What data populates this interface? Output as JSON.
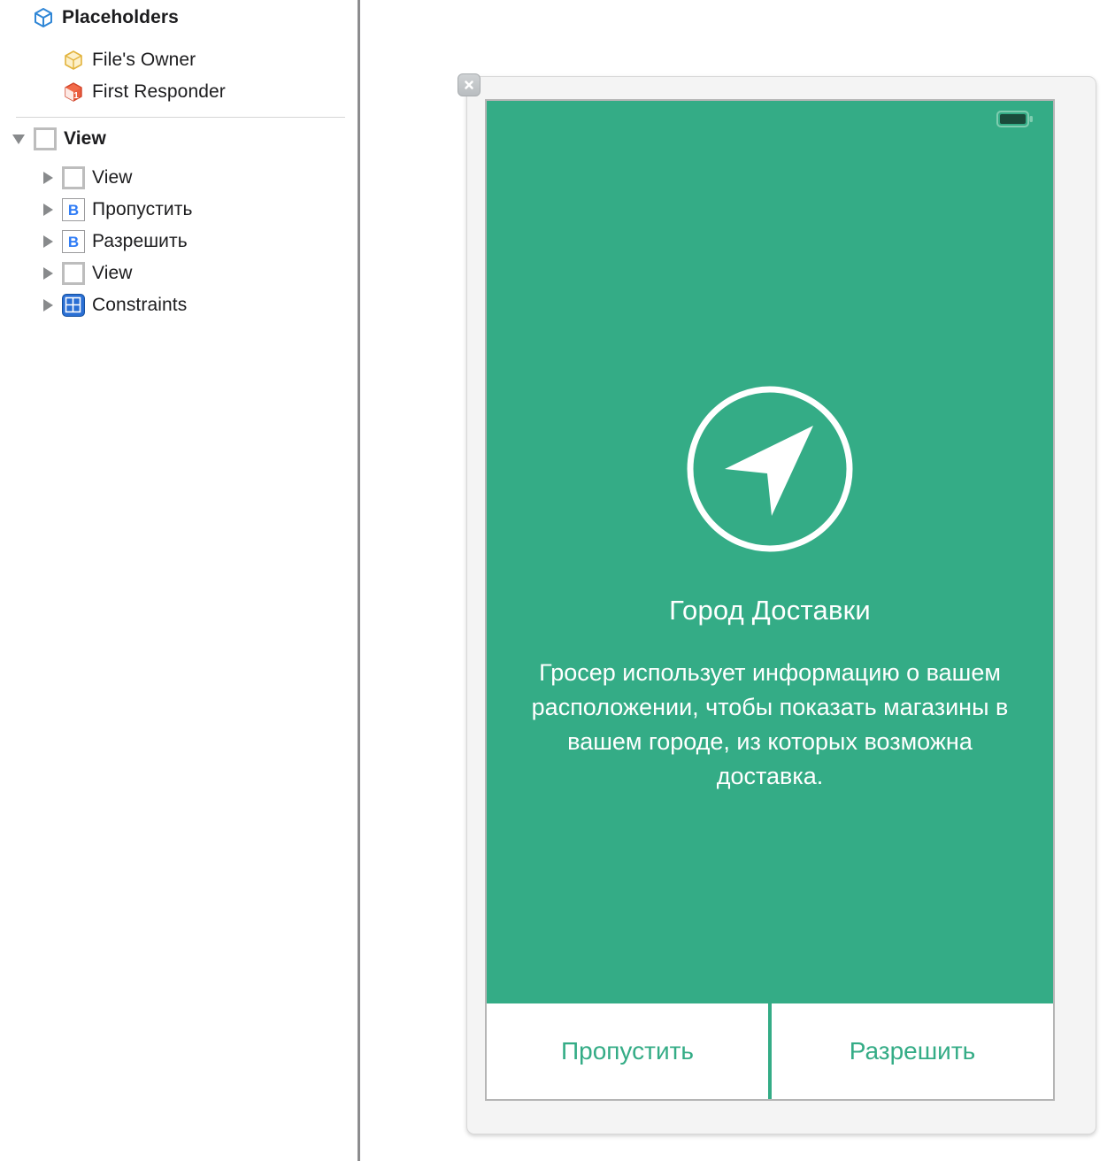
{
  "outline": {
    "sections": [
      {
        "header": {
          "label": "Placeholders",
          "icon": "cube-blue-icon"
        },
        "items": [
          {
            "label": "File's Owner",
            "icon": "cube-yellow-icon"
          },
          {
            "label": "First Responder",
            "icon": "cube-orange-one-icon"
          }
        ]
      }
    ],
    "tree": [
      {
        "label": "View",
        "icon": "view-icon",
        "disclosure": "open",
        "depth": 0,
        "bold": true
      },
      {
        "label": "View",
        "icon": "view-icon",
        "disclosure": "closed",
        "depth": 1,
        "bold": false
      },
      {
        "label": "Пропустить",
        "icon": "button-icon",
        "disclosure": "closed",
        "depth": 1,
        "bold": false
      },
      {
        "label": "Разрешить",
        "icon": "button-icon",
        "disclosure": "closed",
        "depth": 1,
        "bold": false
      },
      {
        "label": "View",
        "icon": "view-icon",
        "disclosure": "closed",
        "depth": 1,
        "bold": false
      },
      {
        "label": "Constraints",
        "icon": "constraints-icon",
        "disclosure": "closed",
        "depth": 1,
        "bold": false
      }
    ]
  },
  "canvas": {
    "close_button": {
      "icon": "close-icon"
    },
    "device": {
      "status_bar": {
        "battery_icon": "battery-full-icon"
      },
      "screen": {
        "background_color": "#34ac86",
        "hero_icon": "location-arrow-circle-icon",
        "title": "Город Доставки",
        "body": "Гросер использует информацию о вашем расположении, чтобы показать магазины в вашем городе, из которых возможна доставка.",
        "buttons": [
          {
            "label": "Пропустить",
            "text_color": "#34ac86"
          },
          {
            "label": "Разрешить",
            "text_color": "#34ac86"
          }
        ]
      }
    }
  },
  "colors": {
    "accent_green": "#34ac86",
    "tree_text": "#1c1c1e",
    "blue": "#2f7cf6"
  }
}
